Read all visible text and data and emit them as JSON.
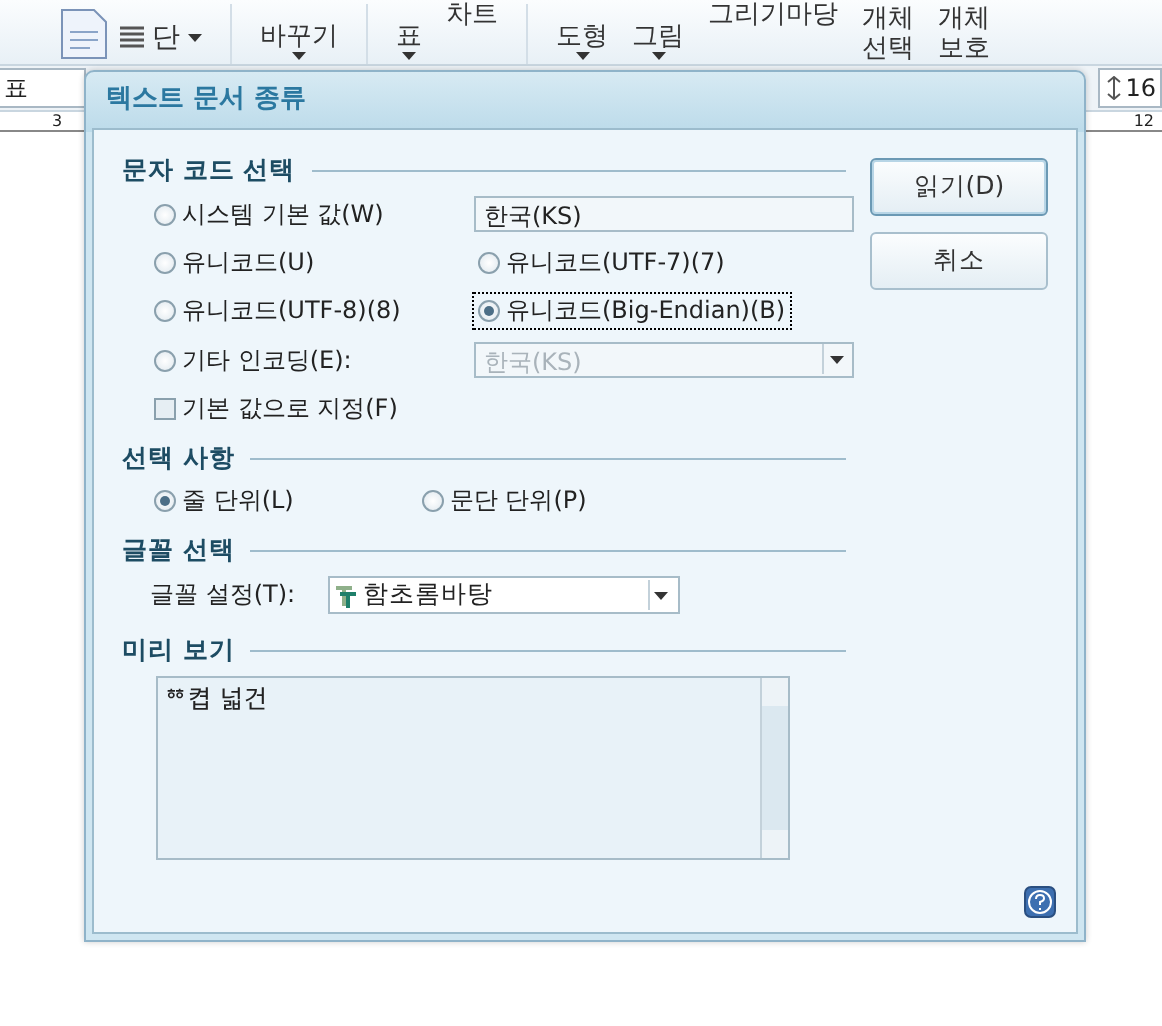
{
  "toolbar": {
    "items": [
      {
        "kind": "doc"
      },
      {
        "kind": "menu",
        "label": "단"
      },
      {
        "kind": "caret",
        "label": "바꾸기"
      },
      {
        "kind": "caret",
        "label": "표"
      },
      {
        "kind": "plain",
        "label": "차트"
      },
      {
        "kind": "caret",
        "label": "도형"
      },
      {
        "kind": "caret",
        "label": "그림"
      },
      {
        "kind": "plain",
        "label": "그리기마당"
      },
      {
        "kind": "two",
        "label": "개체",
        "label2": "선택"
      },
      {
        "kind": "two",
        "label": "개체",
        "label2": "보호"
      }
    ]
  },
  "format_bar": {
    "style_value": "표",
    "spacing_value": "16"
  },
  "ruler": {
    "marks": [
      "3",
      "12"
    ]
  },
  "dialog": {
    "title": "텍스트 문서 종류",
    "encoding": {
      "heading": "문자 코드 선택",
      "options": [
        {
          "label": "시스템 기본 값(W)",
          "selected": false,
          "focused": false,
          "kind": "with_field",
          "field": "한국(KS)"
        },
        {
          "label": "유니코드(U)",
          "selected": false,
          "focused": false,
          "kind": "plain"
        },
        {
          "label": "유니코드(UTF-7)(7)",
          "selected": false,
          "focused": false,
          "kind": "plain"
        },
        {
          "label": "유니코드(UTF-8)(8)",
          "selected": false,
          "focused": false,
          "kind": "plain"
        },
        {
          "label": "유니코드(Big-Endian)(B)",
          "selected": true,
          "focused": true,
          "kind": "plain"
        },
        {
          "label": "기타 인코딩(E):",
          "selected": false,
          "focused": false,
          "kind": "with_combo",
          "field": "한국(KS)",
          "disabled": true
        }
      ],
      "set_default": {
        "label": "기본 값으로 지정(F)",
        "checked": false
      }
    },
    "options": {
      "heading": "선택 사항",
      "choices": [
        {
          "label": "줄 단위(L)",
          "selected": true
        },
        {
          "label": "문단 단위(P)",
          "selected": false
        }
      ]
    },
    "font": {
      "heading": "글꼴 선택",
      "label": "글꼴 설정(T):",
      "value": "함초롬바탕"
    },
    "preview": {
      "heading": "미리 보기",
      "text": "ᅘ켭 넓건"
    },
    "buttons": [
      {
        "label": "읽기(D)",
        "default": true
      },
      {
        "label": "취소",
        "default": false
      }
    ]
  }
}
